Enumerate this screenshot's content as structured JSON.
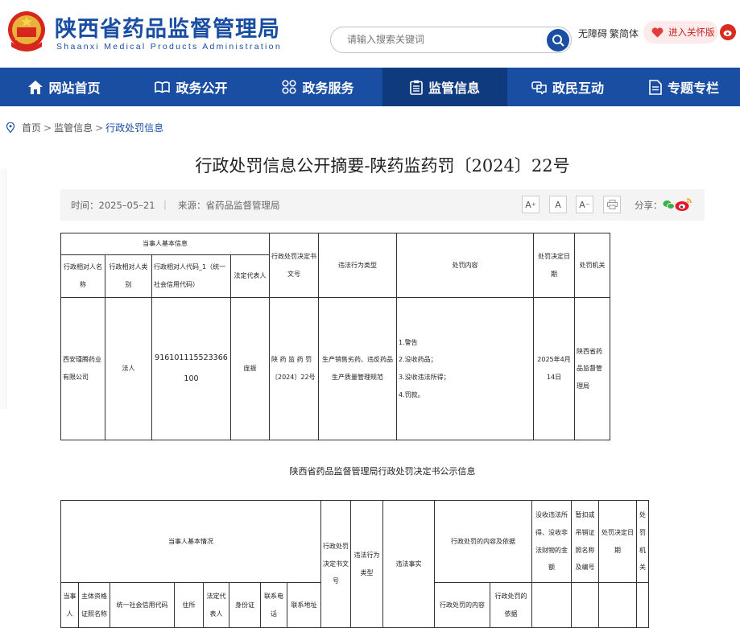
{
  "header": {
    "site_title": "陕西省药品监督管理局",
    "site_subtitle": "Shaanxi Medical Products Administration",
    "search_placeholder": "请输入搜索关键词",
    "accessibility": "无障碍",
    "traditional": "繁简体",
    "care_mode": "进入关怀版",
    "brand_color": "#1a4ea2"
  },
  "nav": {
    "items": [
      {
        "label": "网站首页",
        "icon": "home-icon"
      },
      {
        "label": "政务公开",
        "icon": "book-icon"
      },
      {
        "label": "政务服务",
        "icon": "grid-icon"
      },
      {
        "label": "监管信息",
        "icon": "clipboard-icon",
        "active": true
      },
      {
        "label": "政民互动",
        "icon": "chat-icon"
      },
      {
        "label": "专题专栏",
        "icon": "document-icon"
      }
    ]
  },
  "breadcrumb": {
    "home": "首页",
    "level1": "监管信息",
    "current": "行政处罚信息",
    "sep": ">"
  },
  "article": {
    "title": "行政处罚信息公开摘要-陕药监药罚〔2024〕22号",
    "time": "时间：2025–05–21",
    "source": "来源：省药品监督管理局",
    "share": "分享：",
    "font_up": "A",
    "font_normal": "A",
    "font_down": "A"
  },
  "table1": {
    "group_header": "当事人基本信息",
    "headers": {
      "name": "行政相对人名称",
      "category": "行政相对人类别",
      "code": "行政相对人代码_1（统一社会信用代码）",
      "legal_rep": "法定代表人",
      "doc_no": "行政处罚决定书文号",
      "violation_type": "违法行为类型",
      "content": "处罚内容",
      "date": "处罚决定日期",
      "authority": "处罚机关"
    },
    "row": {
      "name": "西安瑾腾药业有限公司",
      "category": "法人",
      "code": "916101115523366100",
      "legal_rep": "庞振",
      "doc_no": "陕 药 监 药 罚〔2024〕22号",
      "violation_type": "生产销售劣药、违反药品生产质量管理规范",
      "content_lines": [
        "1.警告",
        "2.没收药品；",
        "3.没收违法所得；",
        "4.罚款。"
      ],
      "date": "2025年4月14日",
      "authority": "陕西省药品监督管理局"
    }
  },
  "section2": {
    "title": "陕西省药品监督管理局行政处罚决定书公示信息"
  },
  "table2": {
    "group_header": "当事人基本情况",
    "doc_no": "行政处罚决定书文号",
    "violation_type": "违法行为类型",
    "facts": "违法事实",
    "content_basis": "行政处罚的内容及依据",
    "confiscated": "没收违法所得、没收非法财物的金额",
    "license": "暂扣或吊销证照名称及编号",
    "date": "处罚决定日期",
    "authority": "处罚机关",
    "sub": {
      "party": "当事人",
      "license_name": "主体资格证照名称",
      "credit_code": "统一社会信用代码",
      "address": "住所",
      "legal_rep": "法定代表人",
      "id_card": "身份证",
      "phone": "联系电话",
      "contact_addr": "联系地址",
      "punish_content": "行政处罚的内容",
      "punish_basis": "行政处罚的依据"
    }
  }
}
